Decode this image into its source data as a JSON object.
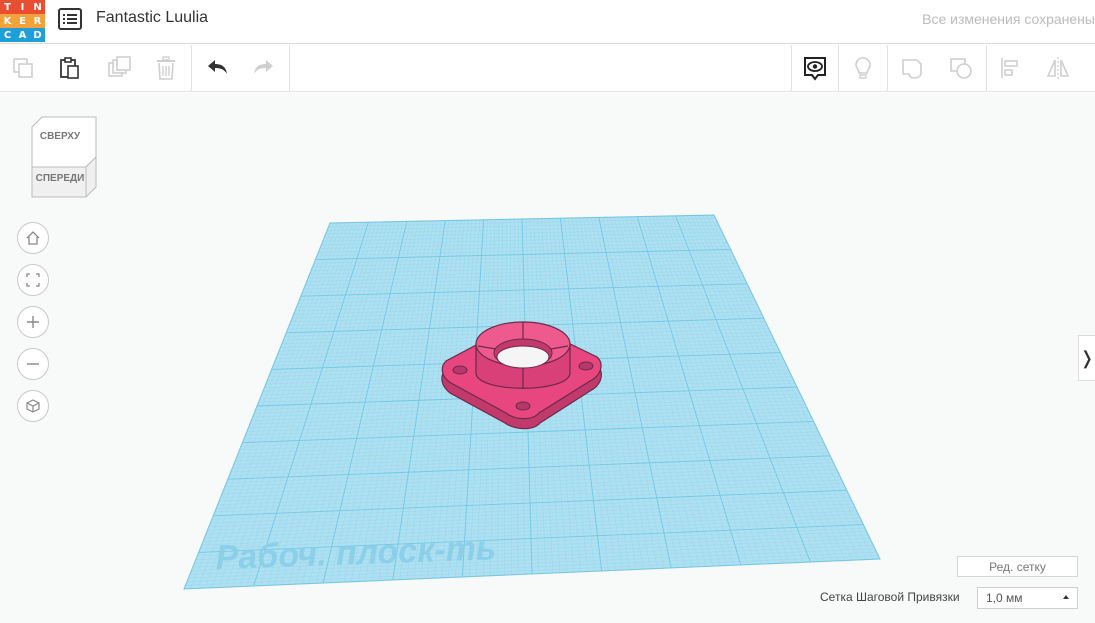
{
  "app": {
    "logo_letters": [
      "T",
      "I",
      "N",
      "K",
      "E",
      "R",
      "C",
      "A",
      "D"
    ],
    "logo_colors": [
      "#e94e33",
      "#e94e33",
      "#e94e33",
      "#f2a13b",
      "#f2a13b",
      "#f2a13b",
      "#1f9fd8",
      "#1f9fd8",
      "#1f9fd8"
    ],
    "design_title": "Fantastic Luulia",
    "save_status": "Все изменения сохранены"
  },
  "toolbar": {
    "items": [
      {
        "icon": "copy-icon",
        "enabled": false
      },
      {
        "icon": "paste-icon",
        "enabled": true
      },
      {
        "icon": "duplicate-icon",
        "enabled": false
      },
      {
        "icon": "trash-icon",
        "enabled": false
      },
      {
        "icon": "undo-icon",
        "enabled": true
      },
      {
        "icon": "redo-icon",
        "enabled": false
      },
      {
        "icon": "notes-eye-icon",
        "enabled": true
      },
      {
        "icon": "lightbulb-icon",
        "enabled": false
      },
      {
        "icon": "group-icon",
        "enabled": false
      },
      {
        "icon": "ungroup-icon",
        "enabled": false
      },
      {
        "icon": "align-icon",
        "enabled": false
      },
      {
        "icon": "mirror-icon",
        "enabled": false
      }
    ]
  },
  "viewcube": {
    "top_label": "СВЕРХУ",
    "front_label": "СПЕРЕДИ"
  },
  "nav_controls": [
    "home-icon",
    "fit-view-icon",
    "zoom-in-icon",
    "zoom-out-icon",
    "perspective-icon"
  ],
  "workplane": {
    "label": "Рабоч. плоск-ть",
    "grid_color": "#6fc7e6",
    "plane_color": "#aee0f1"
  },
  "part": {
    "color": "#e8467f"
  },
  "bottom": {
    "edit_grid_button": "Ред. сетку",
    "snap_grid_label": "Сетка Шаговой Привязки",
    "snap_grid_value": "1,0 мм"
  },
  "side_toggle_glyph": "❭"
}
